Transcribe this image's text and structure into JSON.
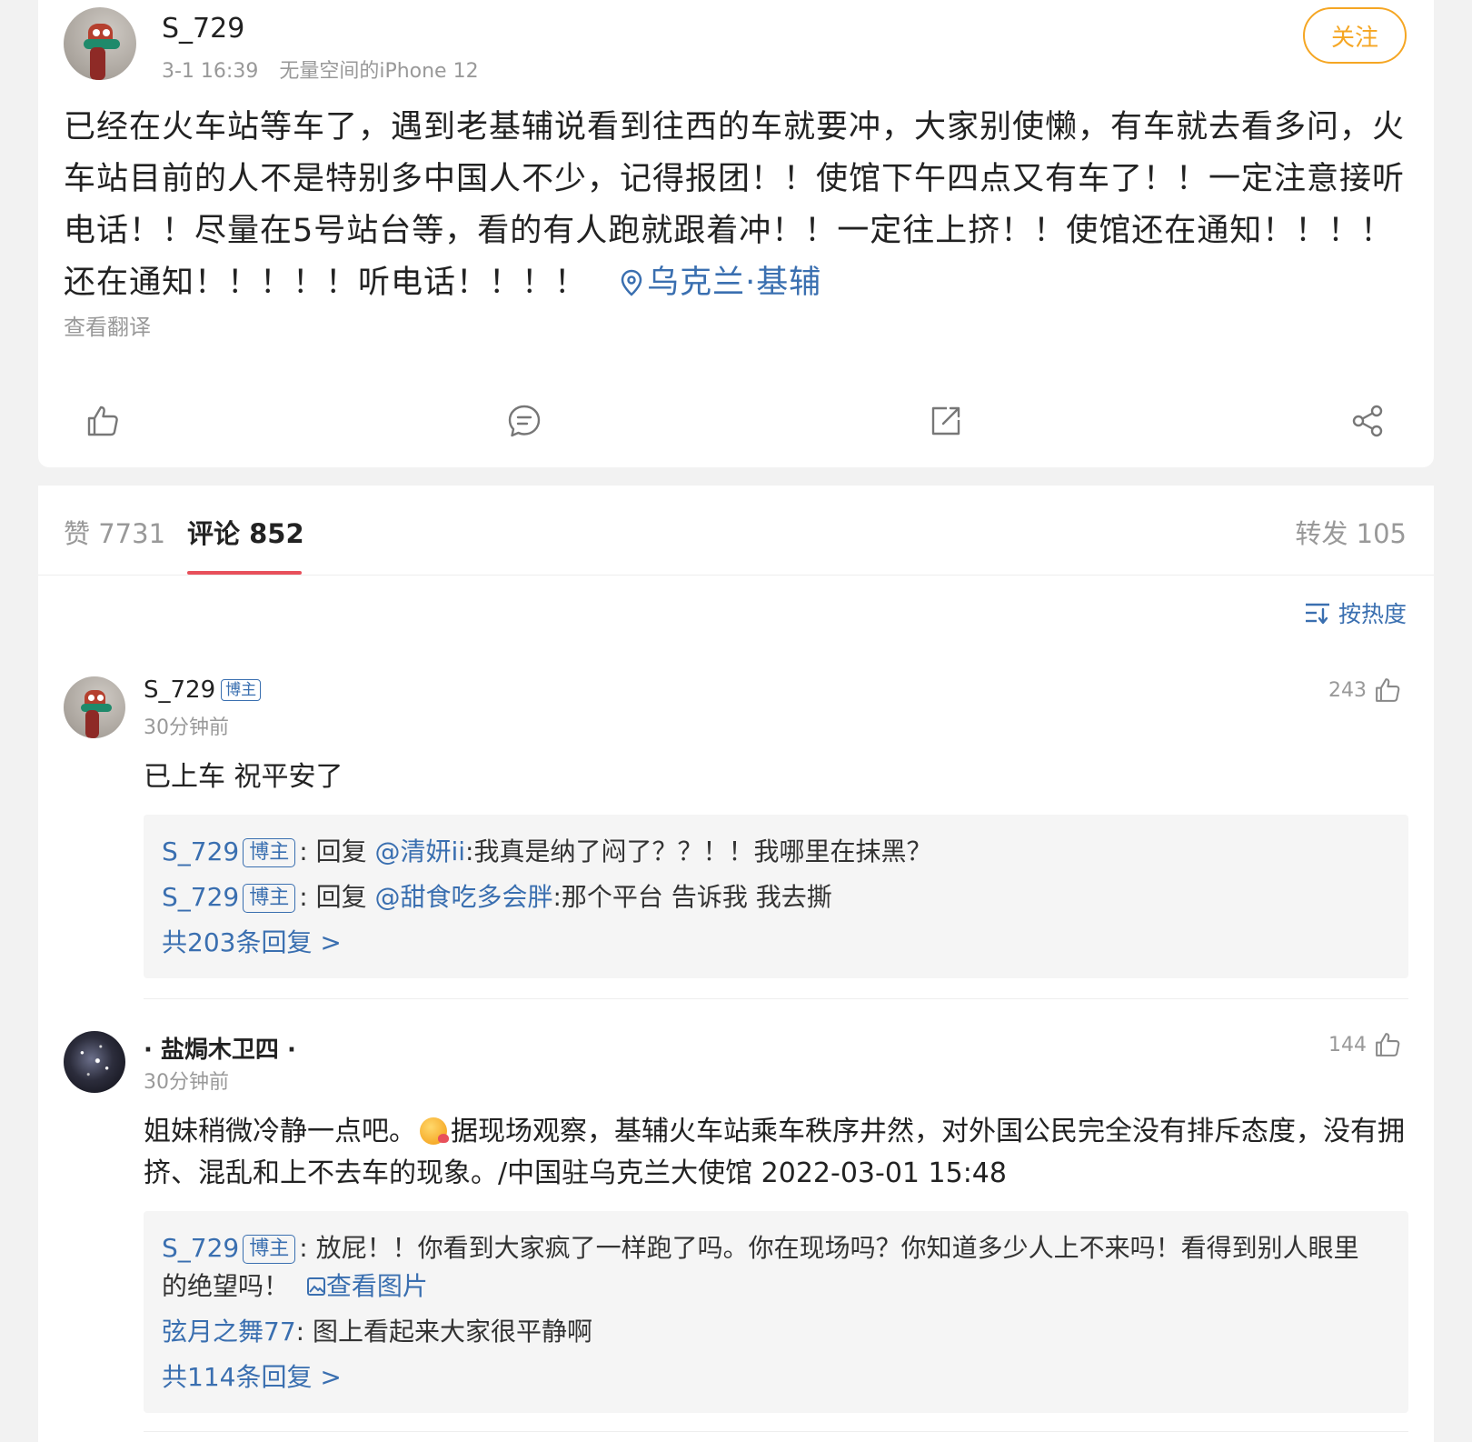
{
  "post": {
    "username": "S_729",
    "time": "3-1 16:39",
    "device": "无量空间的iPhone 12",
    "follow_label": "关注",
    "text": "已经在火车站等车了，遇到老基辅说看到往西的车就要冲，大家别使懒，有车就去看多问，火车站目前的人不是特别多中国人不少，记得报团！！使馆下午四点又有车了！！一定注意接听电话！！尽量在5号站台等，看的有人跑就跟着冲！！一定往上挤！！使馆还在通知！！！！还在通知！！！！！听电话！！！！",
    "location": "乌克兰·基辅",
    "translate": "查看翻译",
    "actions": [
      "like-icon",
      "comment-icon",
      "repost-icon",
      "share-icon"
    ]
  },
  "tabs": {
    "likes": "赞 7731",
    "comments": "评论 852",
    "reposts": "转发 105"
  },
  "sort": {
    "label": "按热度"
  },
  "comments": [
    {
      "username": "S_729",
      "badge": "博主",
      "time": "30分钟前",
      "likes": "243",
      "text": "已上车 祝平安了",
      "replies": [
        {
          "name": "S_729",
          "badge": "博主",
          "prefix": ": 回复 ",
          "at": "@清妍ii",
          "text": ":我真是纳了闷了？？！！我哪里在抹黑？"
        },
        {
          "name": "S_729",
          "badge": "博主",
          "prefix": ": 回复 ",
          "at": "@甜食吃多会胖",
          "text": ":那个平台 告诉我 我去撕"
        }
      ],
      "more": "共203条回复 >"
    },
    {
      "username": "· 盐焗木卫四 ·",
      "time": "30分钟前",
      "likes": "144",
      "text_a": "姐妹稍微冷静一点吧。",
      "text_b": "据现场观察，基辅火车站乘车秩序井然，对外国公民完全没有排斥态度，没有拥挤、混乱和上不去车的现象。/中国驻乌克兰大使馆 2022-03-01 15:48",
      "replies": [
        {
          "name": "S_729",
          "badge": "博主",
          "text": ": 放屁！！你看到大家疯了一样跑了吗。你在现场吗？你知道多少人上不来吗！看得到别人眼里的绝望吗！",
          "image_link": "查看图片"
        },
        {
          "name": "弦月之舞77",
          "text": ": 图上看起来大家很平静啊"
        }
      ],
      "more": "共114条回复 >"
    }
  ]
}
